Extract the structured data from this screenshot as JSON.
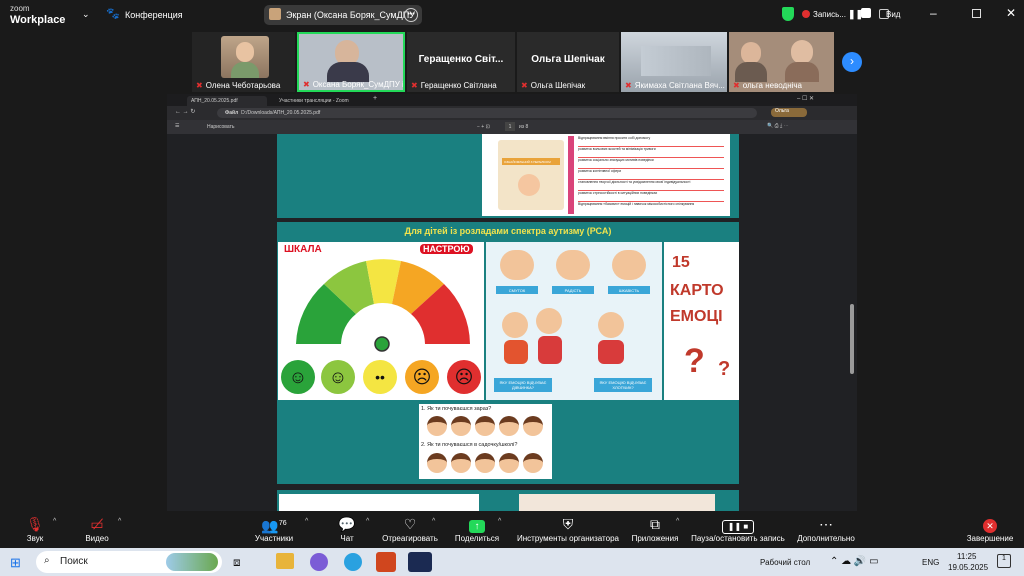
{
  "topbar": {
    "logo_small": "zoom",
    "logo_big": "Workplace",
    "meeting_title": "Конференция",
    "share_title": "Экран (Оксана Боряк_СумДПУ",
    "recording_label": "Запись...",
    "view_label": "Вид"
  },
  "gallery": {
    "participants": [
      {
        "name": "Олена Чеботарьова",
        "muted": true
      },
      {
        "name": "Оксана Боряк_СумДПУ і...",
        "muted": true
      },
      {
        "big_name": "Геращенко  Світ...",
        "name": "Геращенко Світлана",
        "muted": true
      },
      {
        "big_name": "Ольга Шепічак",
        "name": "Ольга Шепічак",
        "muted": true
      },
      {
        "name": "Якимаха Світлана Вяч...",
        "muted": true
      },
      {
        "name": "ольга неводніча",
        "muted": true
      }
    ]
  },
  "browser": {
    "tabs": [
      "АПН_20.05.2025.pdf",
      "Участники трансляции - Zoom"
    ],
    "url_prefix": "Файл",
    "url": "D:/Downloads/АПН_20.05.2025.pdf",
    "pdf_toolbar": {
      "draw_label": "Нарисовать",
      "page_current": "1",
      "page_total": "из 8",
      "profile_label": "Ольга"
    }
  },
  "slide": {
    "section_title": "Для дітей із розладами спектра аутизму (РСА)",
    "scale_left": "ШКАЛА",
    "scale_right": "НАСТРОЮ",
    "emotion_labels": [
      "СМУТОК",
      "РАДІСТЬ",
      "ШКАВІСТЬ"
    ],
    "card_questions": [
      "ЯКУ ЕМОЦІЮ ВІДЧУВАЄ ДІВЧИНКА?",
      "ЯКУ ЕМОЦІЮ ВІДЧУВАЄ ХЛОПЧИК?"
    ],
    "cards_title": [
      "15",
      "КАРТО",
      "ЕМОЦІ"
    ],
    "questions": [
      "Як ти почуваєшся зараз?",
      "Як ти почуваєшся в садочку/школі?"
    ],
    "prev_box_label": "ОЗНАЙОМЛЕНИЙ З ПЕРЕЛІКОМ",
    "prev_list": [
      "Відпрацювання вміння просити собі допомогу",
      "розвиток вольових якостей та мінімізація тривоги",
      "розвиток соціально значущих мотивів поведінки",
      "розвиток когнітивної сфери",
      "становлення творчої діяльності та усвідомлення своєї індивідуальності",
      "розвиток стресостійкості в ситуаційних поведінках",
      "Відпрацювання «базових» емоцій і навичок міжособистісного спілкування"
    ]
  },
  "toolbar": {
    "items": [
      {
        "label": "Звук",
        "icon": "mic-off-icon"
      },
      {
        "label": "Видео",
        "icon": "camera-off-icon"
      },
      {
        "label": "Участники",
        "icon": "participants-icon",
        "count": "76"
      },
      {
        "label": "Чат",
        "icon": "chat-icon"
      },
      {
        "label": "Отреагировать",
        "icon": "heart-icon"
      },
      {
        "label": "Поделиться",
        "icon": "share-icon"
      },
      {
        "label": "Инструменты организатора",
        "icon": "shield-icon"
      },
      {
        "label": "Приложения",
        "icon": "apps-icon"
      },
      {
        "label": "Пауза/остановить запись",
        "icon": "record-control-icon"
      },
      {
        "label": "Дополнительно",
        "icon": "more-icon"
      },
      {
        "label": "Завершение",
        "icon": "end-icon"
      }
    ]
  },
  "taskbar": {
    "search_placeholder": "Поиск",
    "desktop_label": "Рабочий стол",
    "lang": "ENG",
    "time": "11:25",
    "date": "19.05.2025",
    "notif_count": "1"
  },
  "colors": {
    "zoom_green": "#23d959",
    "teal": "#1a8080",
    "red": "#e02f2f",
    "blue": "#2d8cff"
  }
}
